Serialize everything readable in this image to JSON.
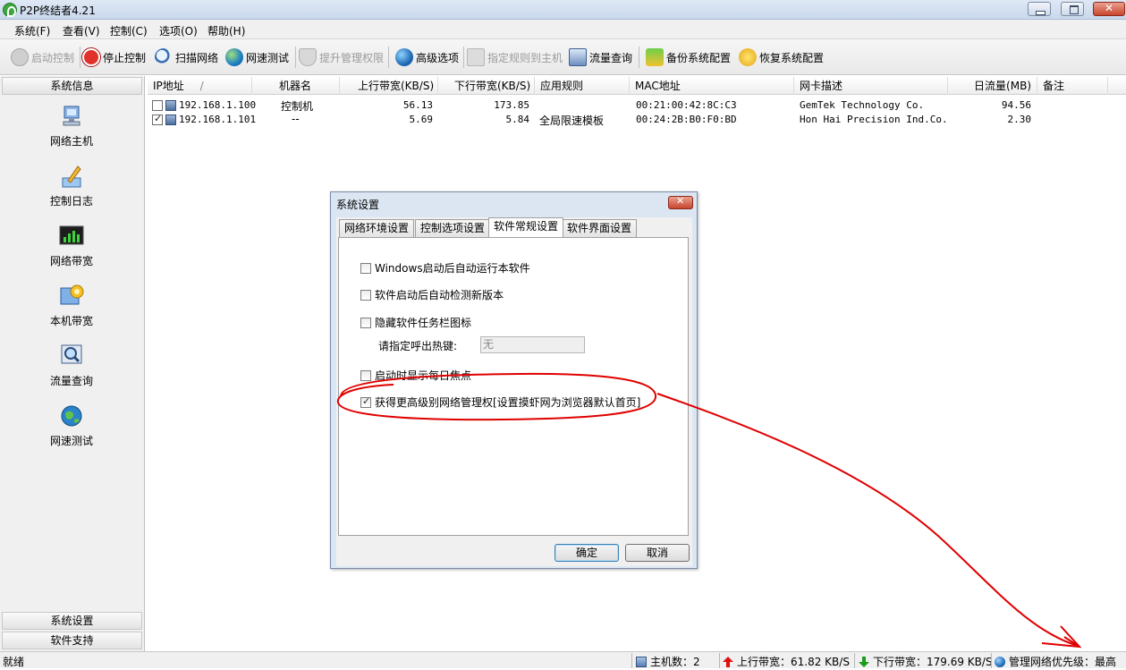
{
  "window": {
    "title": "P2P终结者4.21"
  },
  "menu": [
    "系统(F)",
    "查看(V)",
    "控制(C)",
    "选项(O)",
    "帮助(H)"
  ],
  "toolbar": {
    "start_control": "启动控制",
    "stop_control": "停止控制",
    "scan_network": "扫描网络",
    "speed_test": "网速测试",
    "elevate": "提升管理权限",
    "advanced": "高级选项",
    "assign_rule": "指定规则到主机",
    "traffic_query": "流量查询",
    "backup_config": "备份系统配置",
    "restore_config": "恢复系统配置"
  },
  "sidebar": {
    "header": "系统信息",
    "items": [
      "网络主机",
      "控制日志",
      "网络带宽",
      "本机带宽",
      "流量查询",
      "网速测试"
    ],
    "footer": [
      "系统设置",
      "软件支持"
    ]
  },
  "table": {
    "columns": [
      "IP地址",
      "机器名",
      "上行带宽(KB/S)",
      "下行带宽(KB/S)",
      "应用规则",
      "MAC地址",
      "网卡描述",
      "日流量(MB)",
      "备注"
    ],
    "sort_indicator": "/",
    "rows": [
      {
        "checked": false,
        "ip": "192.168.1.100",
        "name": "控制机",
        "up": "56.13",
        "down": "173.85",
        "rule": "",
        "mac": "00:21:00:42:8C:C3",
        "nic": "GemTek Technology Co.",
        "daily": "94.56",
        "note": ""
      },
      {
        "checked": true,
        "ip": "192.168.1.101",
        "name": "--",
        "up": "5.69",
        "down": "5.84",
        "rule": "全局限速模板",
        "mac": "00:24:2B:B0:F0:BD",
        "nic": "Hon Hai Precision Ind.Co.",
        "daily": "2.30",
        "note": ""
      }
    ]
  },
  "dialog": {
    "title": "系统设置",
    "tabs": [
      "网络环境设置",
      "控制选项设置",
      "软件常规设置",
      "软件界面设置"
    ],
    "active_tab": 2,
    "options": [
      {
        "label": "Windows启动后自动运行本软件",
        "checked": false
      },
      {
        "label": "软件启动后自动检测新版本",
        "checked": false
      },
      {
        "label": "隐藏软件任务栏图标",
        "checked": false
      },
      {
        "label": "启动时显示每日焦点",
        "checked": false
      },
      {
        "label": "获得更高级别网络管理权[设置摸虾网为浏览器默认首页]",
        "checked": true
      }
    ],
    "hotkey_label": "请指定呼出热键:",
    "hotkey_value": "无",
    "ok": "确定",
    "cancel": "取消"
  },
  "statusbar": {
    "ready": "就绪",
    "hosts": "主机数：2",
    "upload": "上行带宽：61.82 KB/S",
    "download": "下行带宽：179.69 KB/S",
    "priority": "管理网络优先级：最高"
  },
  "annotation": {
    "color": "#e00000"
  }
}
